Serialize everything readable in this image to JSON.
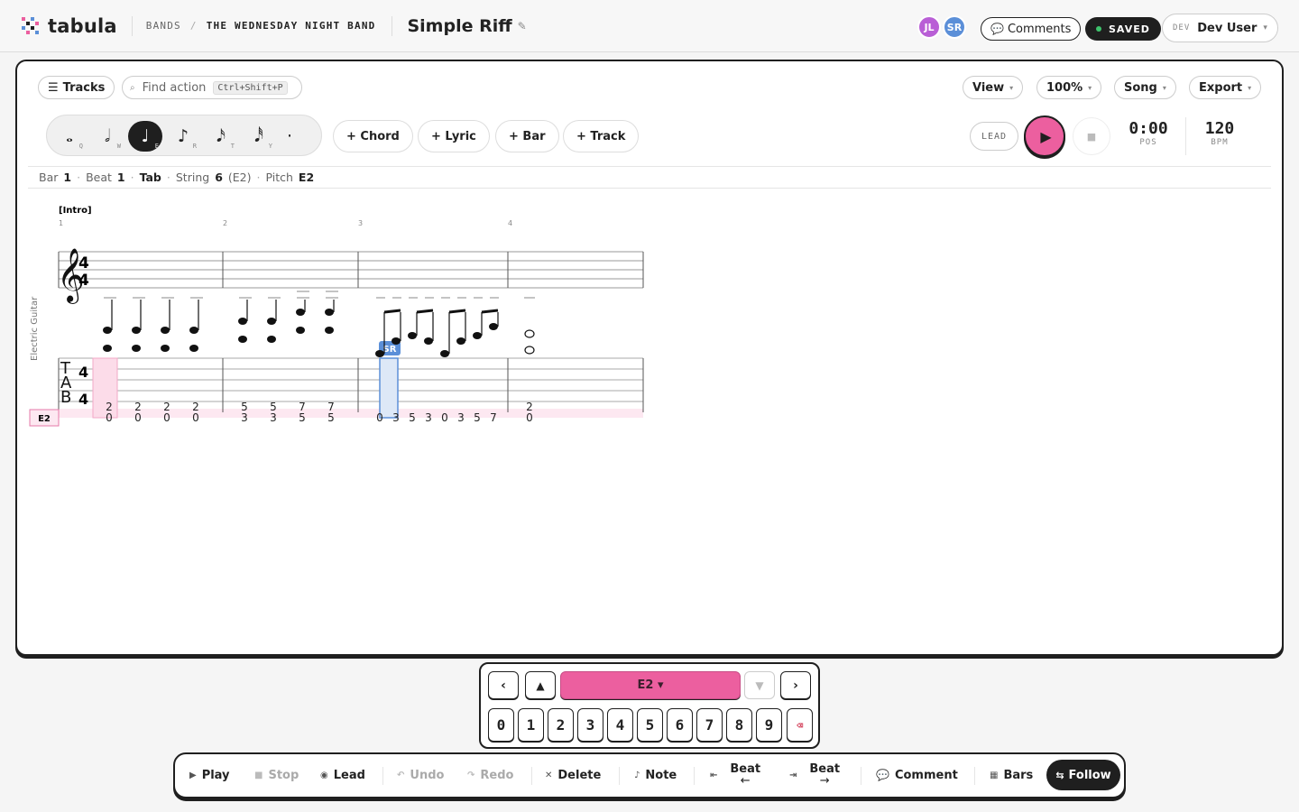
{
  "app": {
    "name": "tabula"
  },
  "breadcrumb": {
    "root": "BANDS",
    "sep": "/",
    "band": "THE WEDNESDAY NIGHT BAND"
  },
  "song": {
    "title": "Simple Riff",
    "edit_icon": "✎"
  },
  "collaborators": [
    {
      "initials": "JL",
      "color": "#b95fd6"
    },
    {
      "initials": "SR",
      "color": "#5b8fd8"
    }
  ],
  "header": {
    "comments_label": "Comments",
    "saved_label": "SAVED",
    "user_env": "DEV",
    "user_name": "Dev User",
    "user_caret": "▾"
  },
  "toolbar": {
    "tracks_label": "Tracks",
    "find_placeholder": "Find action",
    "find_shortcut": "Ctrl+Shift+P",
    "view_label": "View",
    "zoom_label": "100%",
    "mode_label": "Song",
    "export_label": "Export",
    "caret": "▾"
  },
  "durations": [
    {
      "glyph": "𝅝",
      "key": "Q",
      "name": "whole-note"
    },
    {
      "glyph": "𝅗𝅥",
      "key": "W",
      "name": "half-note"
    },
    {
      "glyph": "♩",
      "key": "E",
      "name": "quarter-note",
      "selected": true
    },
    {
      "glyph": "♪",
      "key": "R",
      "name": "eighth-note"
    },
    {
      "glyph": "𝅘𝅥𝅯",
      "key": "T",
      "name": "sixteenth-note"
    },
    {
      "glyph": "𝅘𝅥𝅰",
      "key": "Y",
      "name": "thirty-second-note"
    },
    {
      "glyph": "·",
      "key": "",
      "name": "dot"
    }
  ],
  "add_buttons": {
    "chord": "+ Chord",
    "lyric": "+ Lyric",
    "bar": "+ Bar",
    "track": "+ Track"
  },
  "transport": {
    "lead_label": "LEAD",
    "position": "0:00",
    "position_label": "POS",
    "bpm": "120",
    "bpm_label": "BPM"
  },
  "status": {
    "bar_label": "Bar",
    "bar": "1",
    "beat_label": "Beat",
    "beat": "1",
    "mode": "Tab",
    "string_label": "String",
    "string": "6",
    "string_note": "(E2)",
    "pitch_label": "Pitch",
    "pitch": "E2",
    "sep": "·"
  },
  "score": {
    "section_marker": "[Intro]",
    "track_name": "Electric Guitar",
    "current_string": "E2",
    "bar_numbers": [
      "1",
      "2",
      "3",
      "4"
    ],
    "time_signature": [
      "4",
      "4"
    ],
    "collaborator_tag": "SR",
    "tab_label": [
      "T",
      "A",
      "B"
    ],
    "bars": [
      {
        "beats": [
          {
            "s5": "2",
            "s6": "0"
          },
          {
            "s5": "2",
            "s6": "0"
          },
          {
            "s5": "2",
            "s6": "0"
          },
          {
            "s5": "2",
            "s6": "0"
          }
        ]
      },
      {
        "beats": [
          {
            "s5": "5",
            "s6": "3"
          },
          {
            "s5": "5",
            "s6": "3"
          },
          {
            "s5": "7",
            "s6": "5"
          },
          {
            "s5": "7",
            "s6": "5"
          }
        ]
      },
      {
        "beats": [
          {
            "s6": "0"
          },
          {
            "s6": "3"
          },
          {
            "s6": "5"
          },
          {
            "s6": "3"
          },
          {
            "s6": "0"
          },
          {
            "s6": "3"
          },
          {
            "s6": "5"
          },
          {
            "s6": "7"
          }
        ]
      },
      {
        "beats": [
          {
            "s5": "2",
            "s6": "0"
          }
        ]
      }
    ]
  },
  "keypad": {
    "prev": "‹",
    "up": "▲",
    "string_label": "E2 ▾",
    "down": "▼",
    "next": "›",
    "digits": [
      "0",
      "1",
      "2",
      "3",
      "4",
      "5",
      "6",
      "7",
      "8",
      "9"
    ],
    "delete_icon": "⌫"
  },
  "bottom": {
    "play": "Play",
    "stop": "Stop",
    "lead": "Lead",
    "undo": "Undo",
    "redo": "Redo",
    "delete": "Delete",
    "note": "Note",
    "beat_prev": "Beat",
    "beat_prev_arrow": "←",
    "beat_next": "Beat",
    "beat_next_arrow": "→",
    "comment": "Comment",
    "bars": "Bars",
    "follow": "Follow"
  },
  "colors": {
    "accent": "#ec5f9f",
    "selection": "#5b8fd8",
    "ink": "#1f1f1f"
  }
}
